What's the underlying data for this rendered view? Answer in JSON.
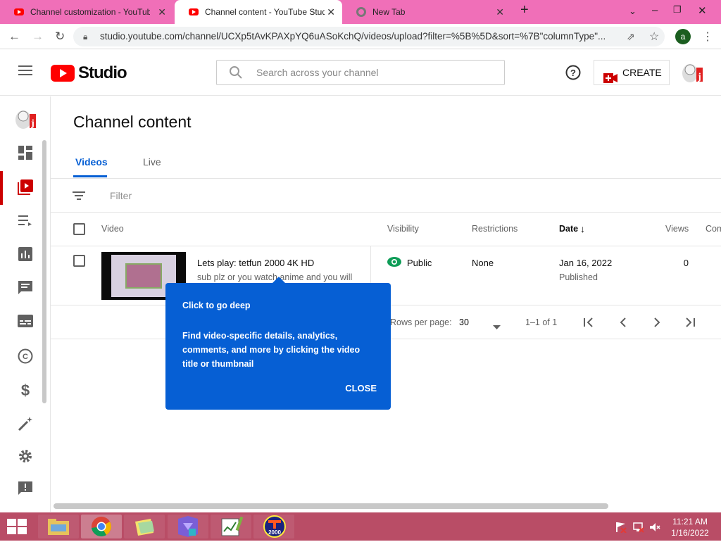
{
  "browser": {
    "tabs": [
      {
        "title": "Channel customization - YouTube"
      },
      {
        "title": "Channel content - YouTube Studio"
      },
      {
        "title": "New Tab"
      }
    ],
    "url": "studio.youtube.com/channel/UCXp5tAvKPAXpYQ6uASoKchQ/videos/upload?filter=%5B%5D&sort=%7B\"columnType\"...",
    "profile_initial": "a"
  },
  "header": {
    "logo_text": "Studio",
    "search_placeholder": "Search across your channel",
    "create_label": "CREATE"
  },
  "page": {
    "title": "Channel content",
    "tabs": [
      "Videos",
      "Live"
    ],
    "filter_label": "Filter"
  },
  "table": {
    "columns": [
      "Video",
      "Visibility",
      "Restrictions",
      "Date",
      "Views",
      "Com"
    ],
    "rows": [
      {
        "title": "Lets play: tetfun 2000 4K HD",
        "description": "sub plz or you watch anime and you will",
        "visibility": "Public",
        "restrictions": "None",
        "date": "Jan 16, 2022",
        "date_status": "Published",
        "views": "0"
      }
    ],
    "pagination": {
      "rows_per_page_label": "Rows per page:",
      "rows_per_page": "30",
      "range": "1–1 of 1"
    }
  },
  "popup": {
    "heading": "Click to go deep",
    "body": "Find video-specific details, analytics, comments, and more by clicking the video title or thumbnail",
    "close_label": "CLOSE"
  },
  "taskbar": {
    "time": "11:21 AM",
    "date": "1/16/2022"
  },
  "colors": {
    "tabstrip": "#f06fb8",
    "accent_blue": "#065fd4",
    "youtube_red": "#ff0000",
    "taskbar": "#b94d66",
    "public_green": "#0f9d58"
  }
}
